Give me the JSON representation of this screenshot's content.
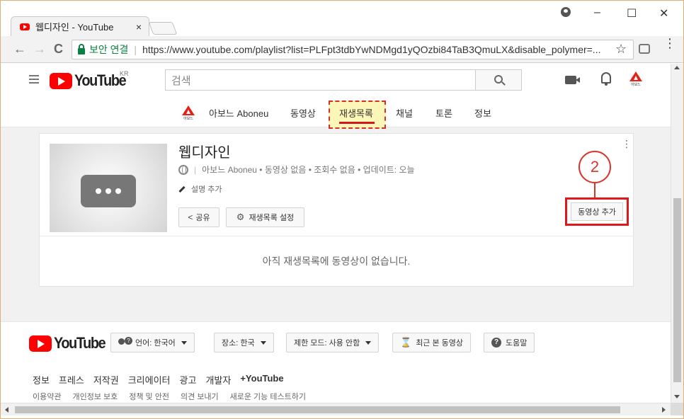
{
  "browser": {
    "tab_title": "웹디자인 - YouTube",
    "tab_close": "×",
    "window_controls": {
      "minimize": "–",
      "maximize": "☐",
      "close": "✕"
    },
    "nav": {
      "back": "←",
      "forward": "→",
      "reload": "C"
    },
    "secure_label": "보안 연결",
    "url": "https://www.youtube.com/playlist?list=PLFpt3tdbYwNDMgd1yQOzbi84TaB3QmuLX&disable_polymer=...",
    "star": "☆",
    "menu": "⋮",
    "icons": [
      "account-icon",
      "lock-icon",
      "star-icon",
      "extension-icon",
      "menu-icon"
    ]
  },
  "header": {
    "logo_text": "YouTube",
    "country": "KR",
    "search_placeholder": "검색",
    "avatar_sub": "아보느"
  },
  "channel_tabs": {
    "logo_sub": "아보느",
    "items": [
      "아보느 Aboneu",
      "동영상",
      "재생목록",
      "채널",
      "토론",
      "정보"
    ],
    "active": "재생목록"
  },
  "playlist": {
    "title": "웹디자인",
    "meta_sep": "|",
    "meta": "아보느 Aboneu • 동영상 없음 • 조회수 없음 • 업데이트: 오늘",
    "add_description": "설명 추가",
    "share_label": "공유",
    "settings_label": "재생목록 설정",
    "add_video_label": "동영상 추가",
    "more": "⋮",
    "empty_message": "아직 재생목록에 동영상이 없습니다."
  },
  "annotation": {
    "step_number": "2",
    "color": "#d9362b"
  },
  "footer": {
    "logo_text": "YouTube",
    "language": "언어: 한국어",
    "location": "장소: 한국",
    "restricted_mode": "제한 모드: 사용 안함",
    "history": "최근 본 동영상",
    "help": "도움말",
    "links": [
      "정보",
      "프레스",
      "저작권",
      "크리에이터",
      "광고",
      "개발자",
      "+YouTube"
    ],
    "sublinks": [
      "이용약관",
      "개인정보 보호",
      "정책 및 안전",
      "의견 보내기",
      "새로운 기능 테스트하기"
    ]
  },
  "colors": {
    "brand_red": "#ff0000",
    "highlight_box": "#e0181e",
    "tab_highlight": "#fcf6b8"
  }
}
